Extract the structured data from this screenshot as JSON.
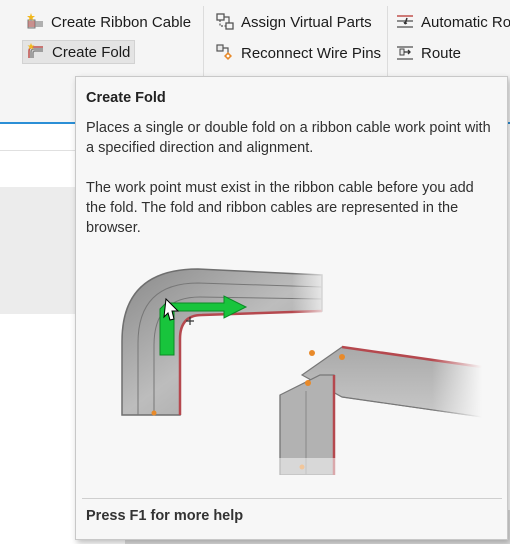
{
  "ribbon": {
    "col1": [
      {
        "label": "Create Ribbon Cable",
        "icon": "ribbon-cable-icon"
      },
      {
        "label": "Create Fold",
        "icon": "fold-icon",
        "active": true
      }
    ],
    "col2": [
      {
        "label": "Assign Virtual Parts",
        "icon": "virtual-parts-icon"
      },
      {
        "label": "Reconnect Wire Pins",
        "icon": "reconnect-pins-icon"
      }
    ],
    "col3": [
      {
        "label": "Automatic Ro",
        "icon": "automatic-route-icon"
      },
      {
        "label": "Route",
        "icon": "route-icon"
      }
    ]
  },
  "tooltip": {
    "title": "Create Fold",
    "description": "Places a single or double fold on a ribbon cable work point with a specified direction and alignment.",
    "detail": "The work point must exist in the ribbon cable before you add the fold. The fold and ribbon cables are represented in the browser.",
    "footer": "Press F1 for more help"
  },
  "colors": {
    "accent": "#2b8fd6",
    "cable_edge": "#b5484e",
    "arrow": "#18c43c",
    "work_point": "#e88a2a"
  }
}
